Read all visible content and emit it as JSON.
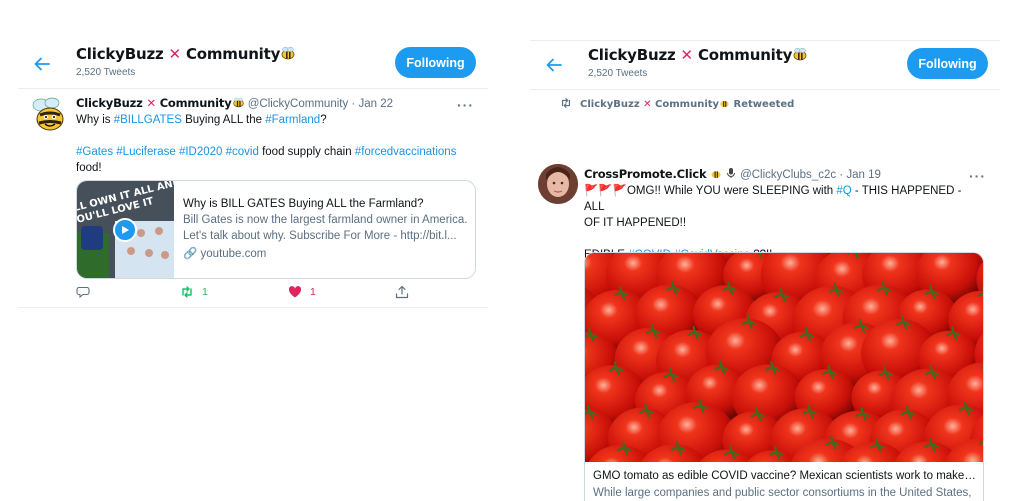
{
  "left": {
    "header": {
      "title": "ClickyBuzz",
      "title_suffix": "Community",
      "tweet_count": "2,520 Tweets",
      "follow_label": "Following"
    },
    "tweet": {
      "name": "ClickyBuzz",
      "name_suffix": "Community",
      "handle": "@ClickyCommunity",
      "dot": "·",
      "date": "Jan 22",
      "line1_pre": "Why is ",
      "line1_tag1": "#BILLGATES",
      "line1_mid": " Buying ALL the ",
      "line1_tag2": "#Farmland",
      "line1_post": "?",
      "tags2": [
        "#Gates",
        "#Luciferase",
        "#ID2020",
        "#covid"
      ],
      "line2_mid": " food supply chain ",
      "line2_tag": "#forcedvaccinations",
      "line3": "food!",
      "card": {
        "thumb_text": "I'LL OWN IT ALL AND YOU'LL LOVE IT",
        "title": "Why is BILL GATES Buying ALL the Farmland?",
        "desc": "Bill Gates is now the largest farmland owner in America. Let's talk about why. Subscribe For More - http://bit.l...",
        "domain": "youtube.com"
      },
      "actions": {
        "reply_count": "",
        "retweet_count": "1",
        "like_count": "1"
      }
    }
  },
  "right": {
    "header": {
      "title": "ClickyBuzz",
      "title_suffix": "Community",
      "tweet_count": "2,520 Tweets",
      "follow_label": "Following"
    },
    "retweet_line": {
      "name": "ClickyBuzz",
      "suffix": "Community",
      "label": "Retweeted"
    },
    "tweet": {
      "name": "CrossPromote.Click",
      "handle": "@ClickyClubs_c2c",
      "dot": "·",
      "date": "Jan 19",
      "line1_pre": "OMG!! While YOU were SLEEPING with ",
      "line1_tag": "#Q",
      "line1_post": " - THIS HAPPENED - ALL",
      "line2": "OF IT HAPPENED!!",
      "line3_pre": "EDIBLE ",
      "line3_tag1": "#COVID",
      "line3_tag2": "#CovidVaccine",
      "line3_post": " ??!!",
      "card": {
        "title": "GMO tomato as edible COVID vaccine? Mexican scientists work to make i...",
        "desc": "While large companies and public sector consortiums in the United States, Canada, China and Europe are running at full speed to develop a vaccine ..."
      }
    }
  },
  "colors": {
    "accent": "#1d9bf0",
    "link": "#1b95e0",
    "like": "#e0245e",
    "retweet": "#17bf63",
    "muted": "#5b7083"
  }
}
